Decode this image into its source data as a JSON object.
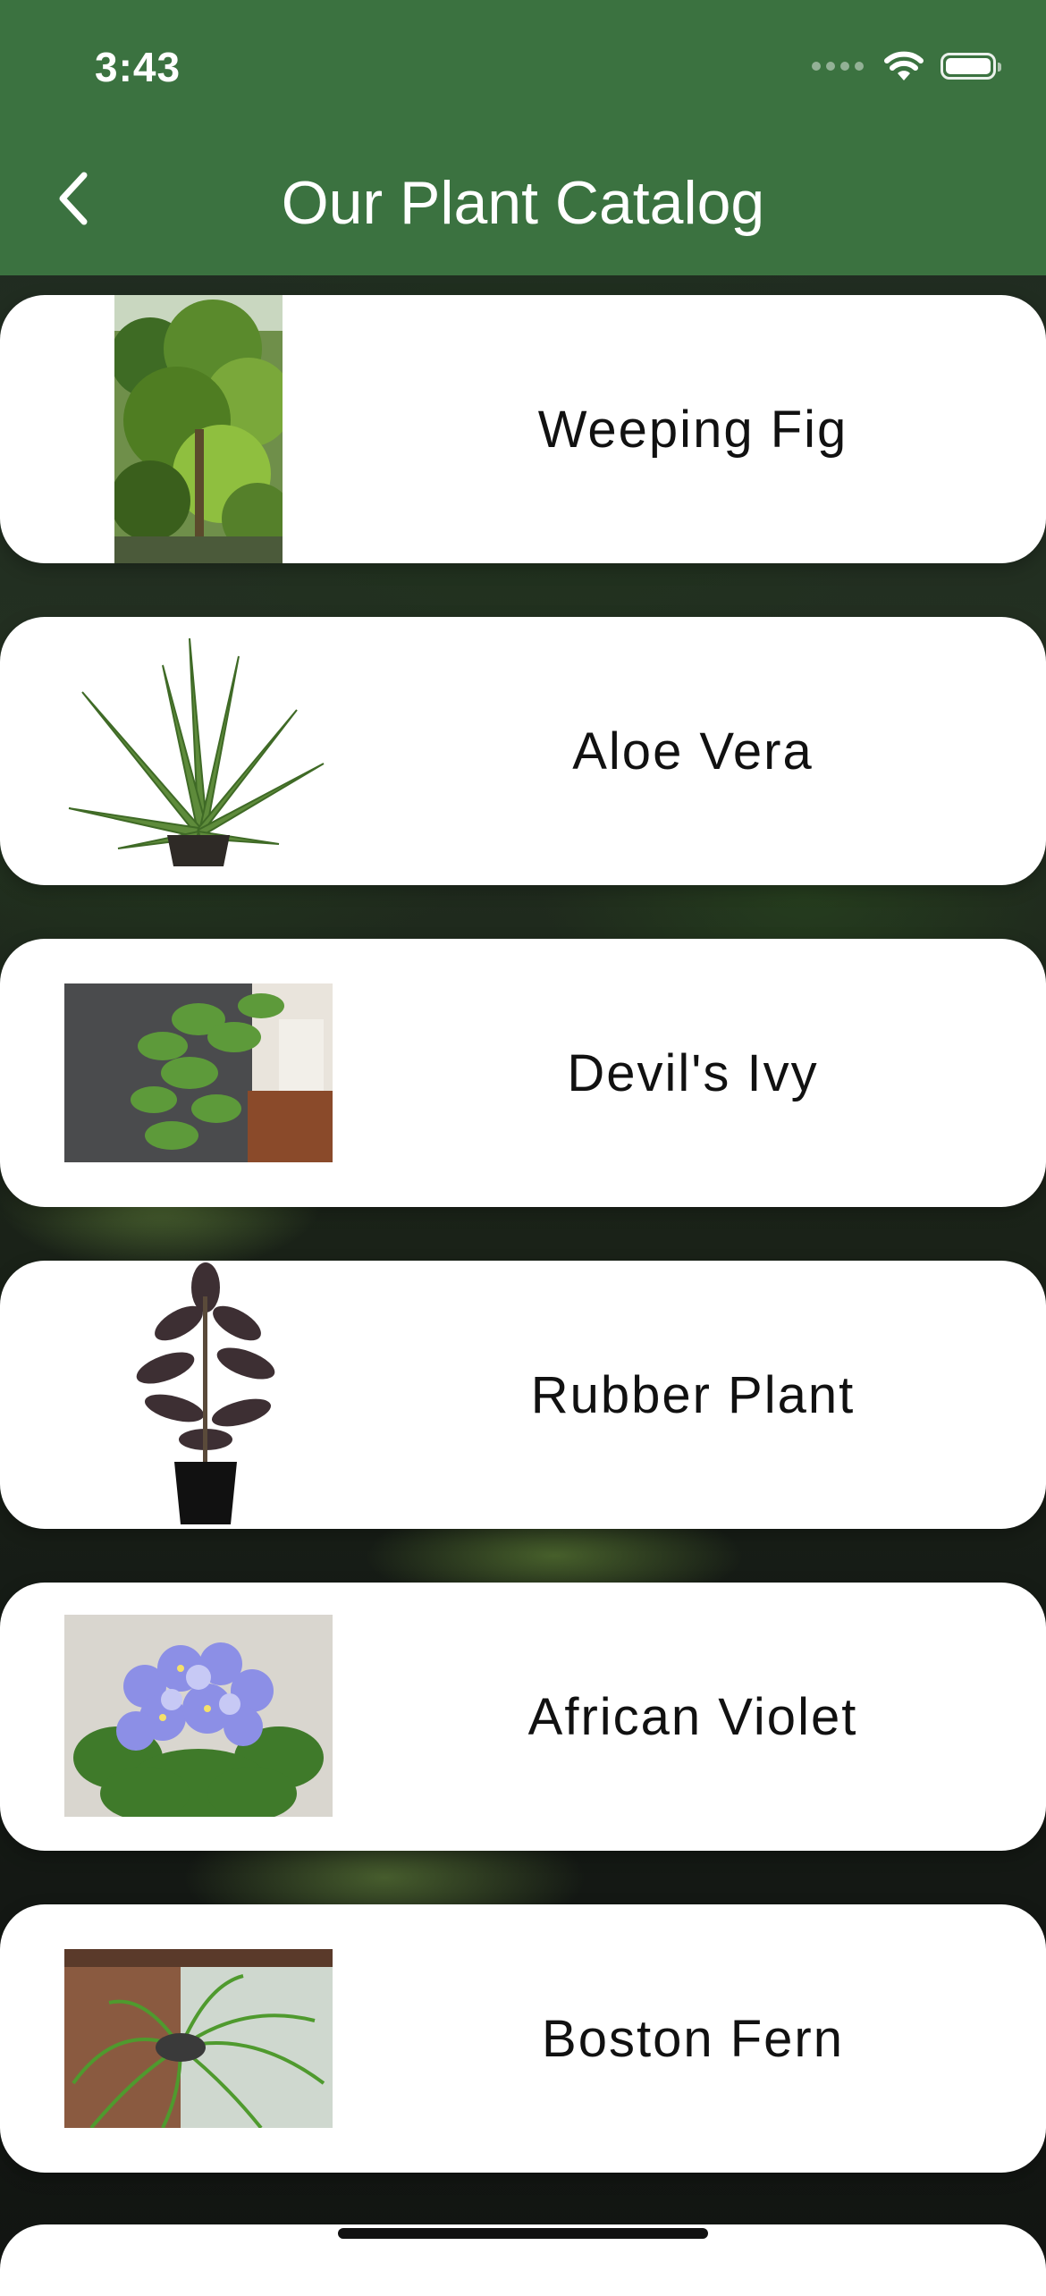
{
  "status_bar": {
    "time": "3:43"
  },
  "header": {
    "title": "Our Plant Catalog",
    "background_color": "#3b7240",
    "back_icon": "chevron-left-icon"
  },
  "plants": [
    {
      "name": "Weeping Fig"
    },
    {
      "name": "Aloe Vera"
    },
    {
      "name": "Devil's Ivy"
    },
    {
      "name": "Rubber Plant"
    },
    {
      "name": "African Violet"
    },
    {
      "name": "Boston Fern"
    }
  ]
}
